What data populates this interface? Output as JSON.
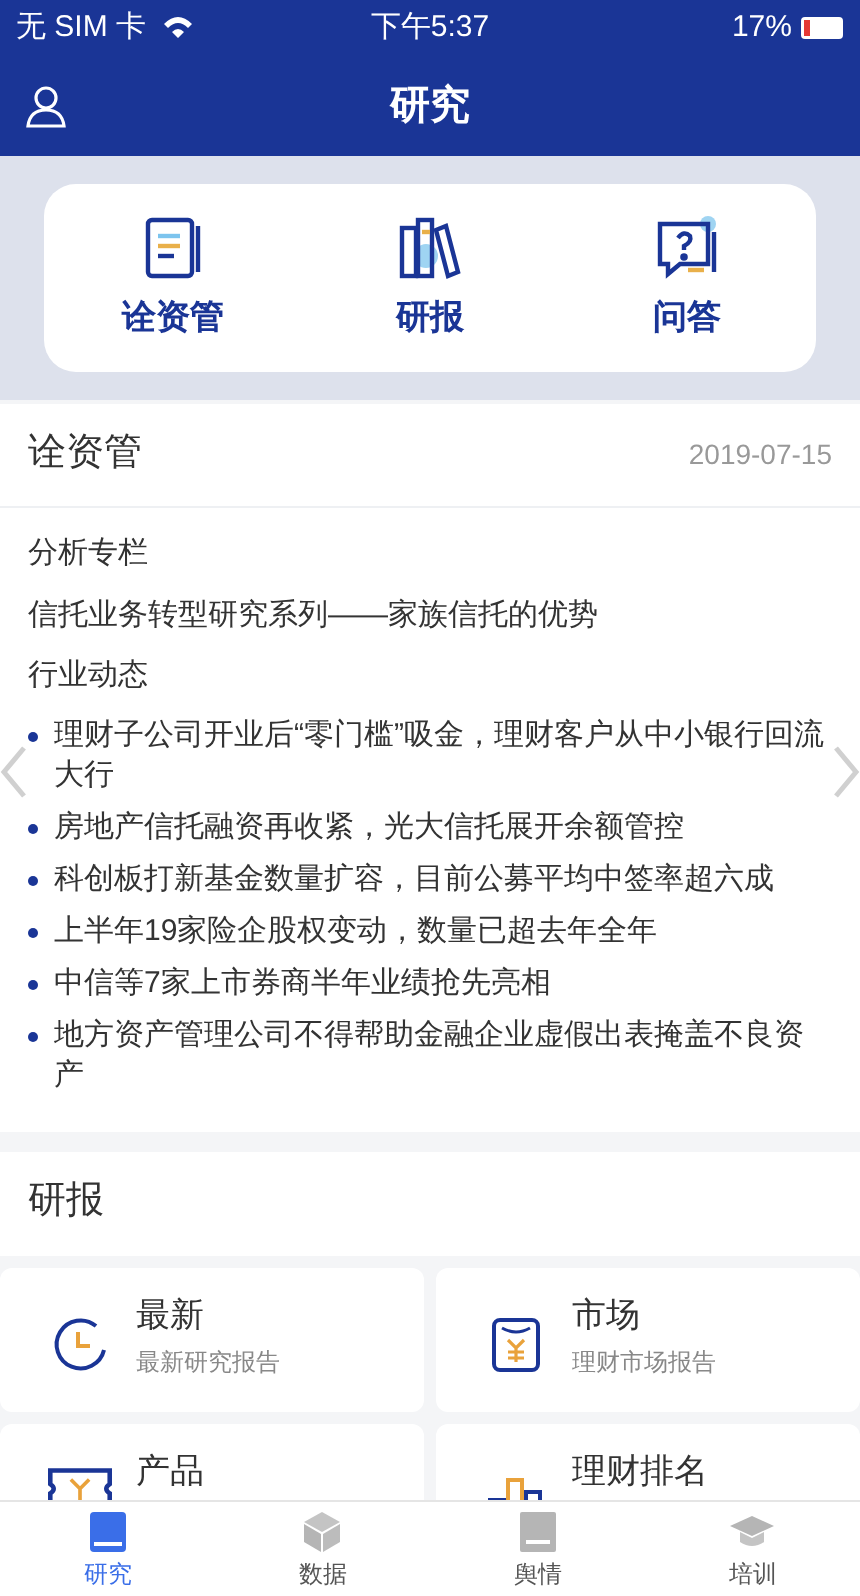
{
  "status_bar": {
    "carrier": "无 SIM 卡",
    "time": "下午5:37",
    "battery": "17%"
  },
  "header": {
    "title": "研究"
  },
  "shortcuts": [
    {
      "kind": "doc",
      "label": "诠资管"
    },
    {
      "kind": "books",
      "label": "研报"
    },
    {
      "kind": "qa",
      "label": "问答"
    }
  ],
  "digest": {
    "title": "诠资管",
    "date": "2019-07-15",
    "column_heading": "分析专栏",
    "column_article": "信托业务转型研究系列——家族信托的优势",
    "news_heading": "行业动态",
    "news": [
      "理财子公司开业后“零门槛”吸金，理财客户从中小银行回流大行",
      "房地产信托融资再收紧，光大信托展开余额管控",
      "科创板打新基金数量扩容，目前公募平均中签率超六成",
      "上半年19家险企股权变动，数量已超去年全年",
      "中信等7家上市券商半年业绩抢先亮相",
      "地方资产管理公司不得帮助金融企业虚假出表掩盖不良资产"
    ]
  },
  "reports": {
    "title": "研报",
    "cards": [
      {
        "kind": "clock",
        "title": "最新",
        "subtitle": "最新研究报告"
      },
      {
        "kind": "market",
        "title": "市场",
        "subtitle": "理财市场报告"
      },
      {
        "kind": "product",
        "title": "产品"
      },
      {
        "kind": "ranking",
        "title": "理财排名"
      }
    ]
  },
  "tab_bar": [
    {
      "kind": "research",
      "label": "研究",
      "selected": true
    },
    {
      "kind": "data",
      "label": "数据",
      "selected": false
    },
    {
      "kind": "news",
      "label": "舆情",
      "selected": false
    },
    {
      "kind": "training",
      "label": "培训",
      "selected": false
    }
  ]
}
